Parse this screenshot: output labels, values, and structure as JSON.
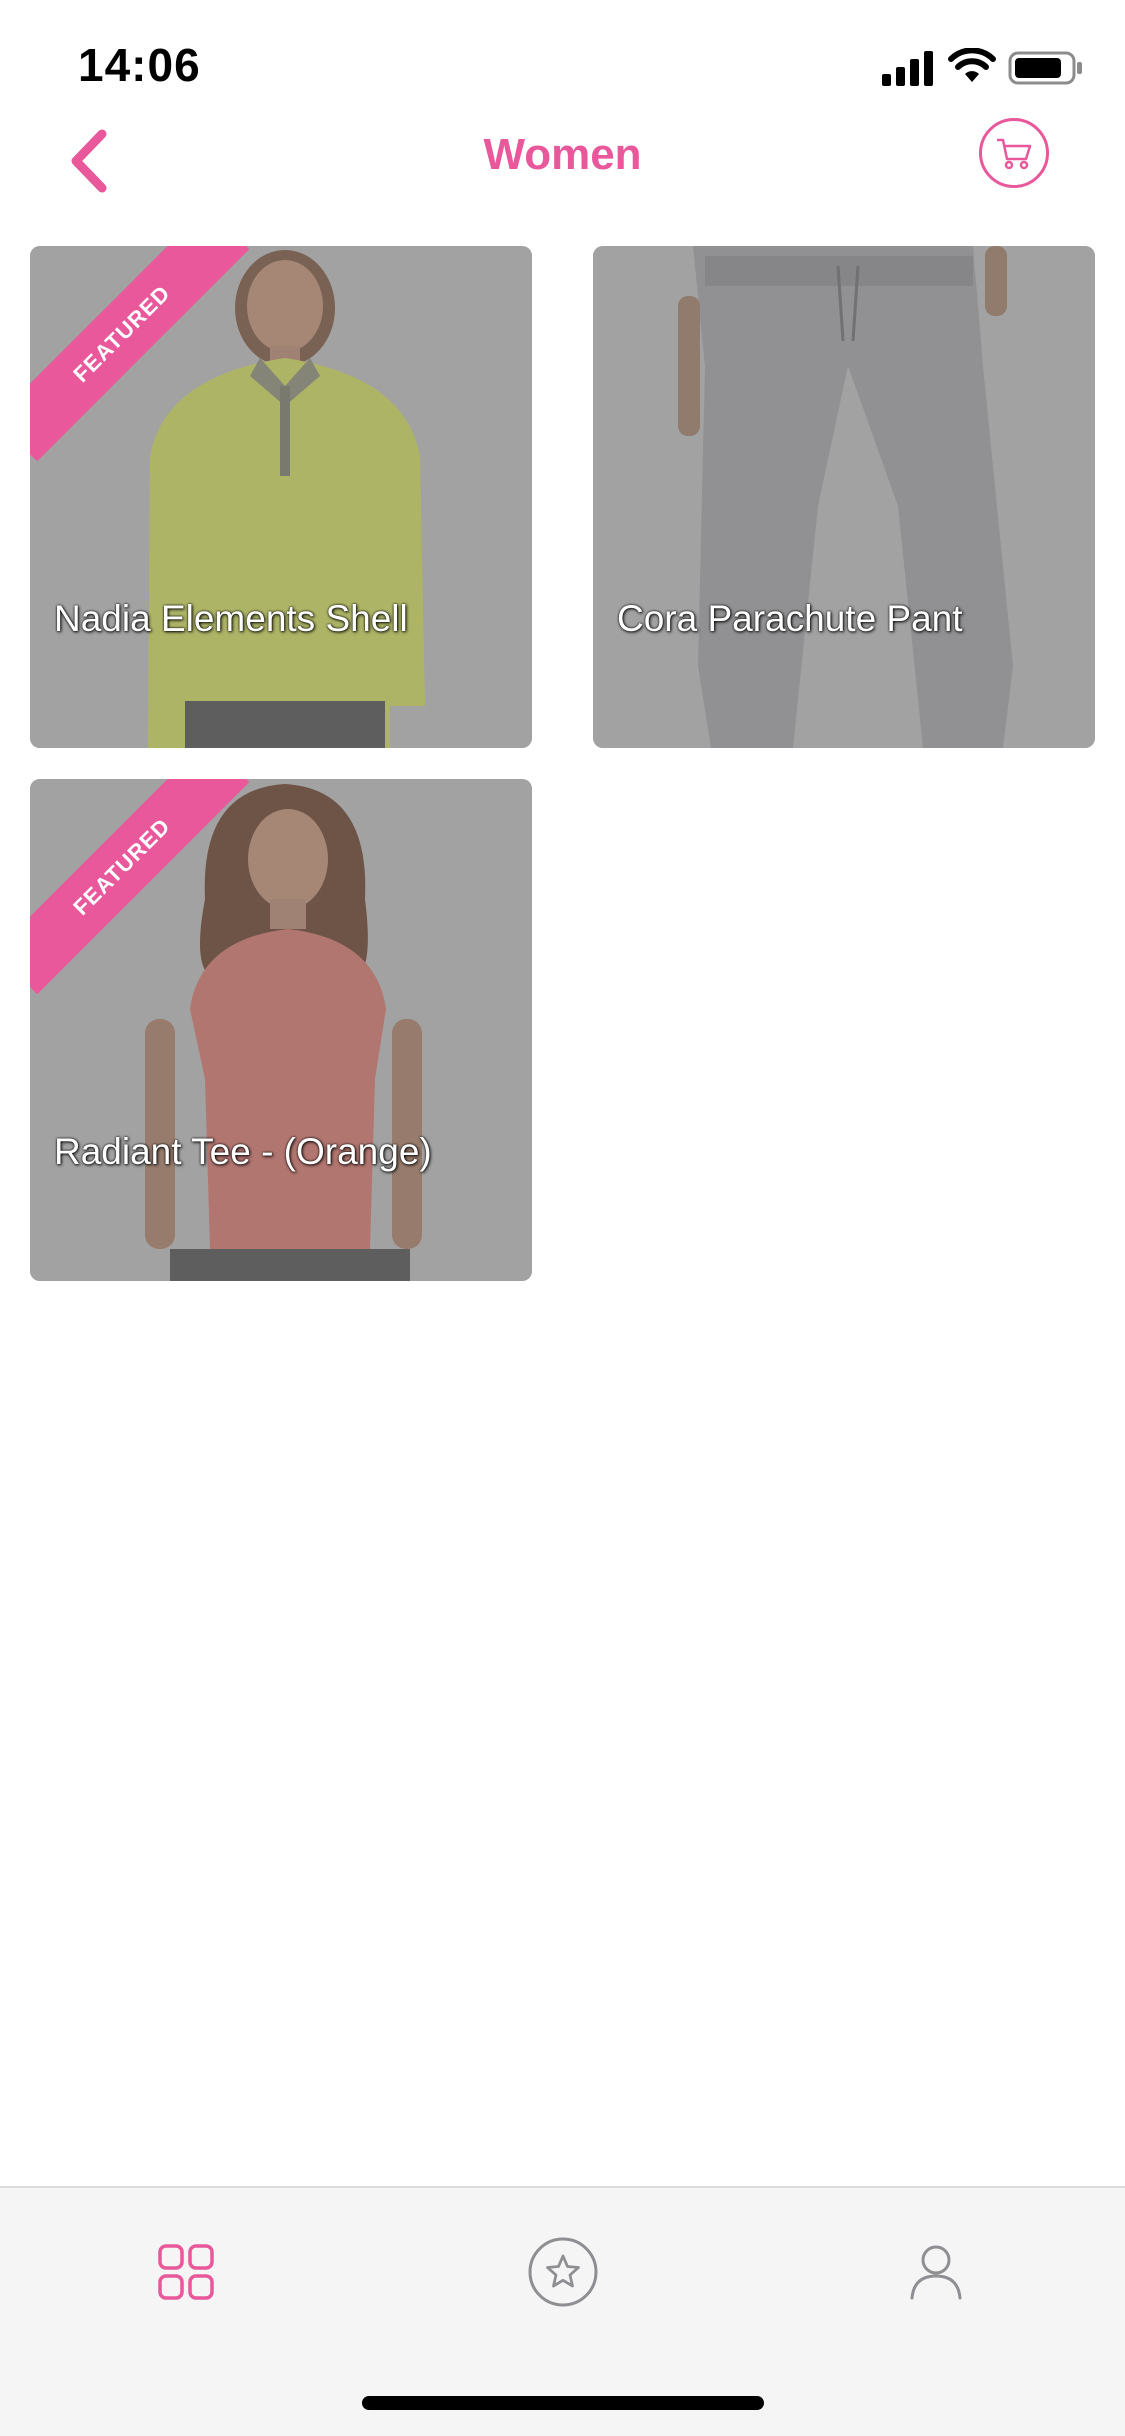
{
  "status_bar": {
    "time": "14:06"
  },
  "header": {
    "title": "Women",
    "back_icon": "chevron-left-icon",
    "cart_icon": "cart-icon"
  },
  "colors": {
    "accent": "#e8589b",
    "card_bg": "#adadad",
    "tab_bar_bg": "#f5f5f5"
  },
  "products": [
    {
      "name": "Nadia Elements Shell",
      "featured": true,
      "badge": "FEATURED"
    },
    {
      "name": "Cora Parachute Pant",
      "featured": false,
      "badge": ""
    },
    {
      "name": "Radiant Tee - (Orange)",
      "featured": true,
      "badge": "FEATURED"
    }
  ],
  "tab_bar": {
    "tabs": [
      {
        "icon": "grid-icon",
        "active": true
      },
      {
        "icon": "star-icon",
        "active": false
      },
      {
        "icon": "profile-icon",
        "active": false
      }
    ]
  }
}
